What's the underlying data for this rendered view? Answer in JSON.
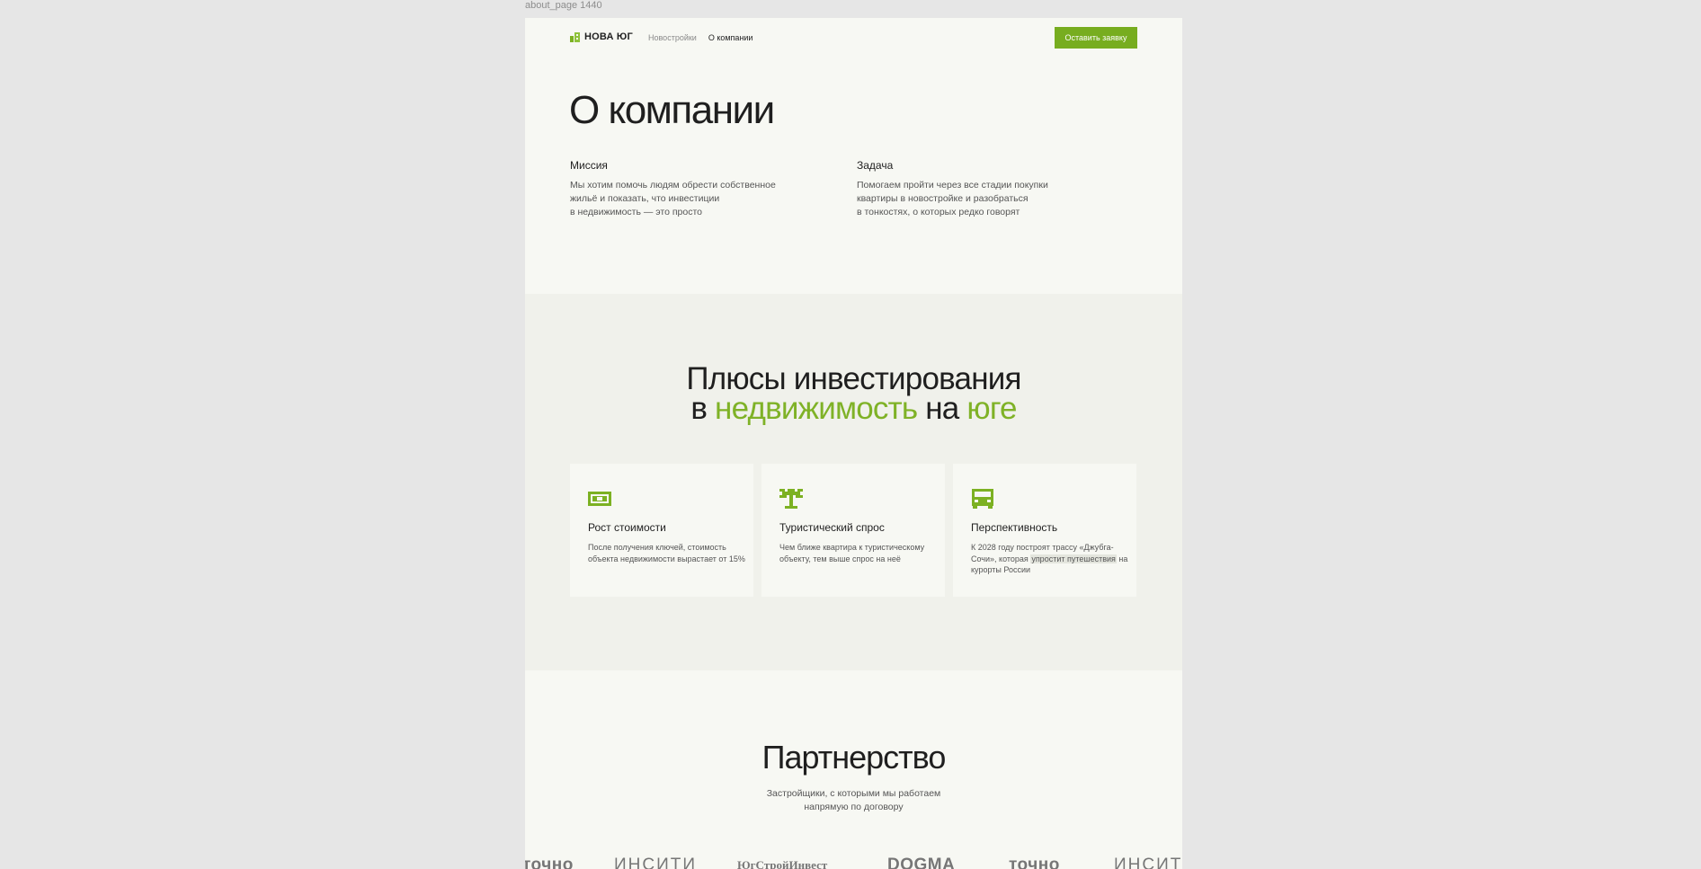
{
  "frame_label": "about_page 1440",
  "header": {
    "brand": "НОВА ЮГ",
    "nav": [
      {
        "label": "Новостройки",
        "active": false
      },
      {
        "label": "О компании",
        "active": true
      }
    ],
    "cta": "Оставить заявку"
  },
  "about": {
    "title": "О компании",
    "mission": {
      "heading": "Миссия",
      "text": "Мы хотим помочь людям обрести собственное\nжильё и показать, что инвестиции\nв недвижимость — это просто"
    },
    "task": {
      "heading": "Задача",
      "text": "Помогаем пройти через все стадии покупки\nквартиры в новостройке и разобраться\nв тонкостях, о которых редко говорят"
    }
  },
  "benefits": {
    "title_line1": "Плюсы инвестирования",
    "title_line2_a": "в",
    "title_line2_b": "недвижимость",
    "title_line2_c": "на",
    "title_line2_d": "юге",
    "cards": [
      {
        "icon": "money-icon",
        "title": "Рост стоимости",
        "text": "После получения ключей, стоимость объекта недвижимости вырастает от 15%"
      },
      {
        "icon": "palm-tree-icon",
        "title": "Туристический спрос",
        "text": "Чем ближе квартира к туристическому объекту, тем выше спрос на неё"
      },
      {
        "icon": "bus-icon",
        "title": "Перспективность",
        "text_a": "К 2028 году построят трассу «Джубга-Сочи», которая",
        "text_mark": "упростит путешествия",
        "text_b": "на курорты России"
      }
    ]
  },
  "partners": {
    "title": "Партнерство",
    "subtitle": "Застройщики, с которыми мы работаем\nнапрямую по договору",
    "logos": [
      "точно",
      "ИНСИТИ",
      "ЮгСтройИнвест",
      "DOGMA",
      "точно",
      "ИНСИТИ"
    ]
  },
  "colors": {
    "accent": "#77ad1f",
    "page_bg": "#f7f8f3",
    "section_bg": "#f0f1eb",
    "canvas_bg": "#e6e6e6"
  }
}
